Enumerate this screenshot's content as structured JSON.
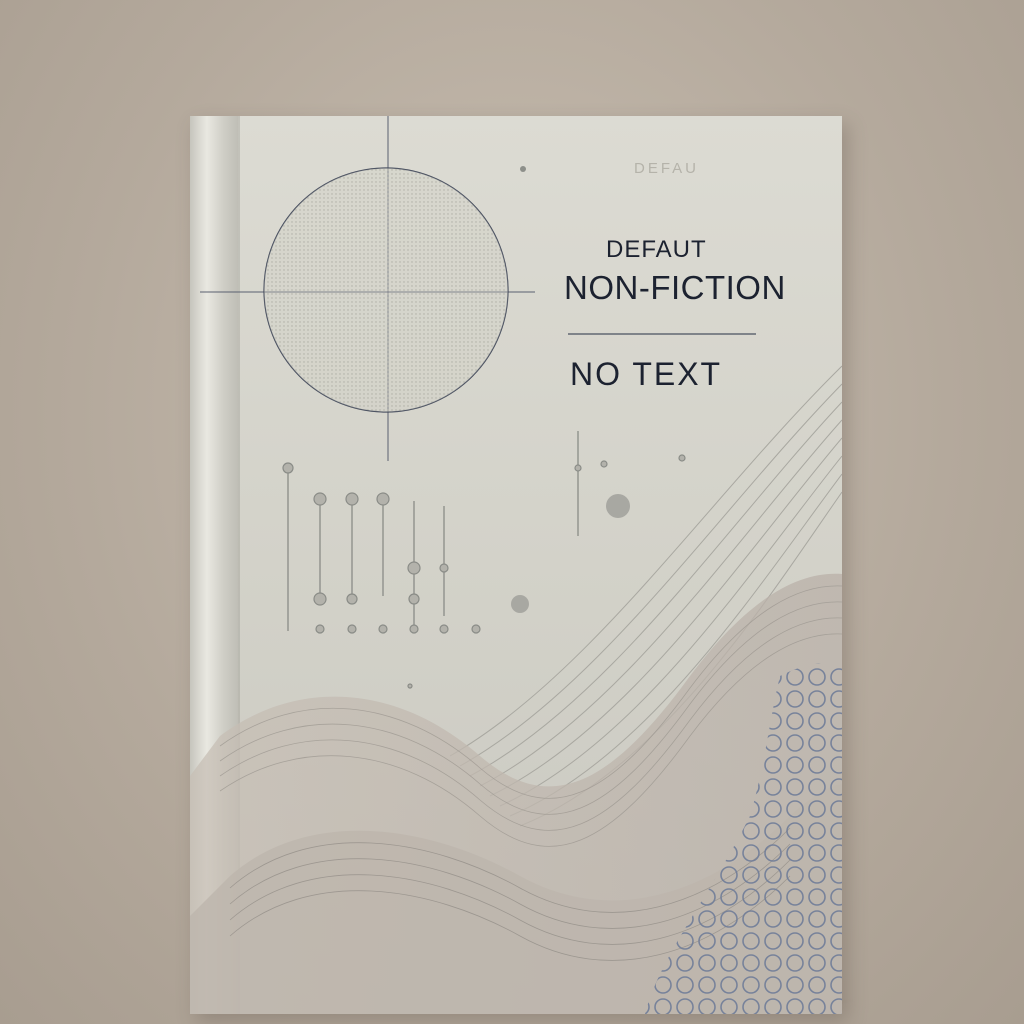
{
  "cover": {
    "ghost_text": "DEFAU",
    "small_title": "DEFAUT",
    "main_title": "NON-FICTION",
    "subtitle": "NO TEXT"
  },
  "colors": {
    "background": "#b4a99c",
    "cover": "#d4d3ca",
    "ink": "#1c2230",
    "accent_pattern": "#7c88a0"
  }
}
